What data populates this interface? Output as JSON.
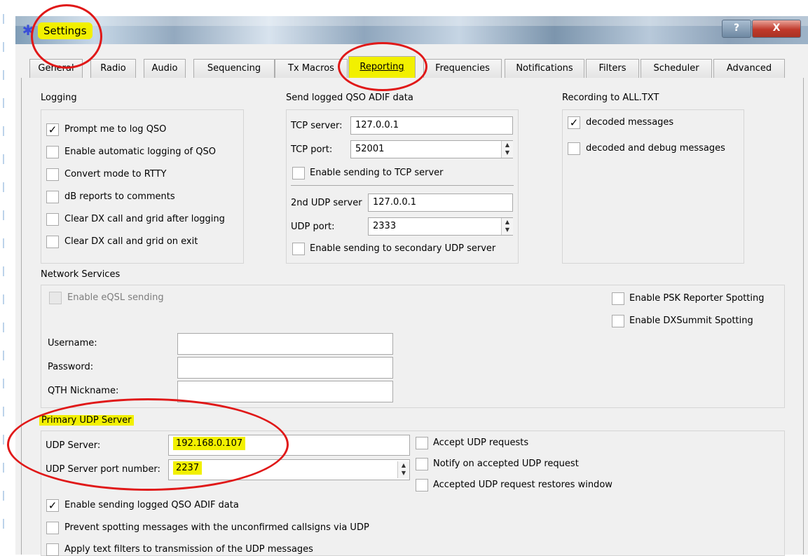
{
  "window": {
    "title": "Settings",
    "help_label": "?",
    "close_label": "X"
  },
  "tabs": [
    {
      "label": "General"
    },
    {
      "label": "Radio"
    },
    {
      "label": "Audio"
    },
    {
      "label": "Sequencing"
    },
    {
      "label": "Tx Macros"
    },
    {
      "label": "Reporting",
      "active": true
    },
    {
      "label": "Frequencies"
    },
    {
      "label": "Notifications"
    },
    {
      "label": "Filters"
    },
    {
      "label": "Scheduler"
    },
    {
      "label": "Advanced"
    }
  ],
  "logging": {
    "title": "Logging",
    "items": [
      {
        "label": "Prompt me to log QSO",
        "checked": "✓"
      },
      {
        "label": "Enable automatic logging of QSO",
        "checked": ""
      },
      {
        "label": "Convert mode to RTTY",
        "checked": ""
      },
      {
        "label": "dB reports to comments",
        "checked": ""
      },
      {
        "label": "Clear DX call and grid after logging",
        "checked": ""
      },
      {
        "label": "Clear DX call and grid on exit",
        "checked": ""
      }
    ]
  },
  "adif": {
    "title": "Send logged QSO ADIF data",
    "tcp_server_label": "TCP server:",
    "tcp_server_value": "127.0.0.1",
    "tcp_port_label": "TCP port:",
    "tcp_port_value": "52001",
    "enable_tcp_label": "Enable sending to TCP server",
    "udp2_server_label": "2nd UDP server",
    "udp2_server_value": "127.0.0.1",
    "udp_port_label": "UDP port:",
    "udp_port_value": "2333",
    "enable_udp2_label": "Enable sending to secondary UDP server"
  },
  "recording": {
    "title": "Recording to ALL.TXT",
    "decoded_label": "decoded messages",
    "decoded_checked": "✓",
    "debug_label": "decoded and debug messages"
  },
  "network": {
    "title": "Network Services",
    "eqsl_label": "Enable eQSL sending",
    "psk_label": "Enable PSK Reporter Spotting",
    "dxsummit_label": "Enable DXSummit Spotting",
    "username_label": "Username:",
    "password_label": "Password:",
    "qth_label": "QTH Nickname:"
  },
  "udp": {
    "title": "Primary UDP Server",
    "server_label": "UDP Server:",
    "server_value": "192.168.0.107",
    "port_label": "UDP Server port number:",
    "port_value": "2237",
    "accept_label": "Accept UDP requests",
    "notify_label": "Notify on accepted UDP request",
    "restore_label": "Accepted UDP request restores window",
    "send_adif_label": "Enable sending logged QSO ADIF data",
    "send_adif_checked": "✓",
    "prevent_label": "Prevent spotting messages with the unconfirmed callsigns via UDP",
    "filters_label": "Apply text filters to transmission of the UDP messages"
  },
  "colors": {
    "highlight": "#f2f000",
    "annotation": "#e01818",
    "checkmark": "✓"
  },
  "icons": {
    "app": "asterisk-icon",
    "spin": "spin-arrows-icon"
  }
}
